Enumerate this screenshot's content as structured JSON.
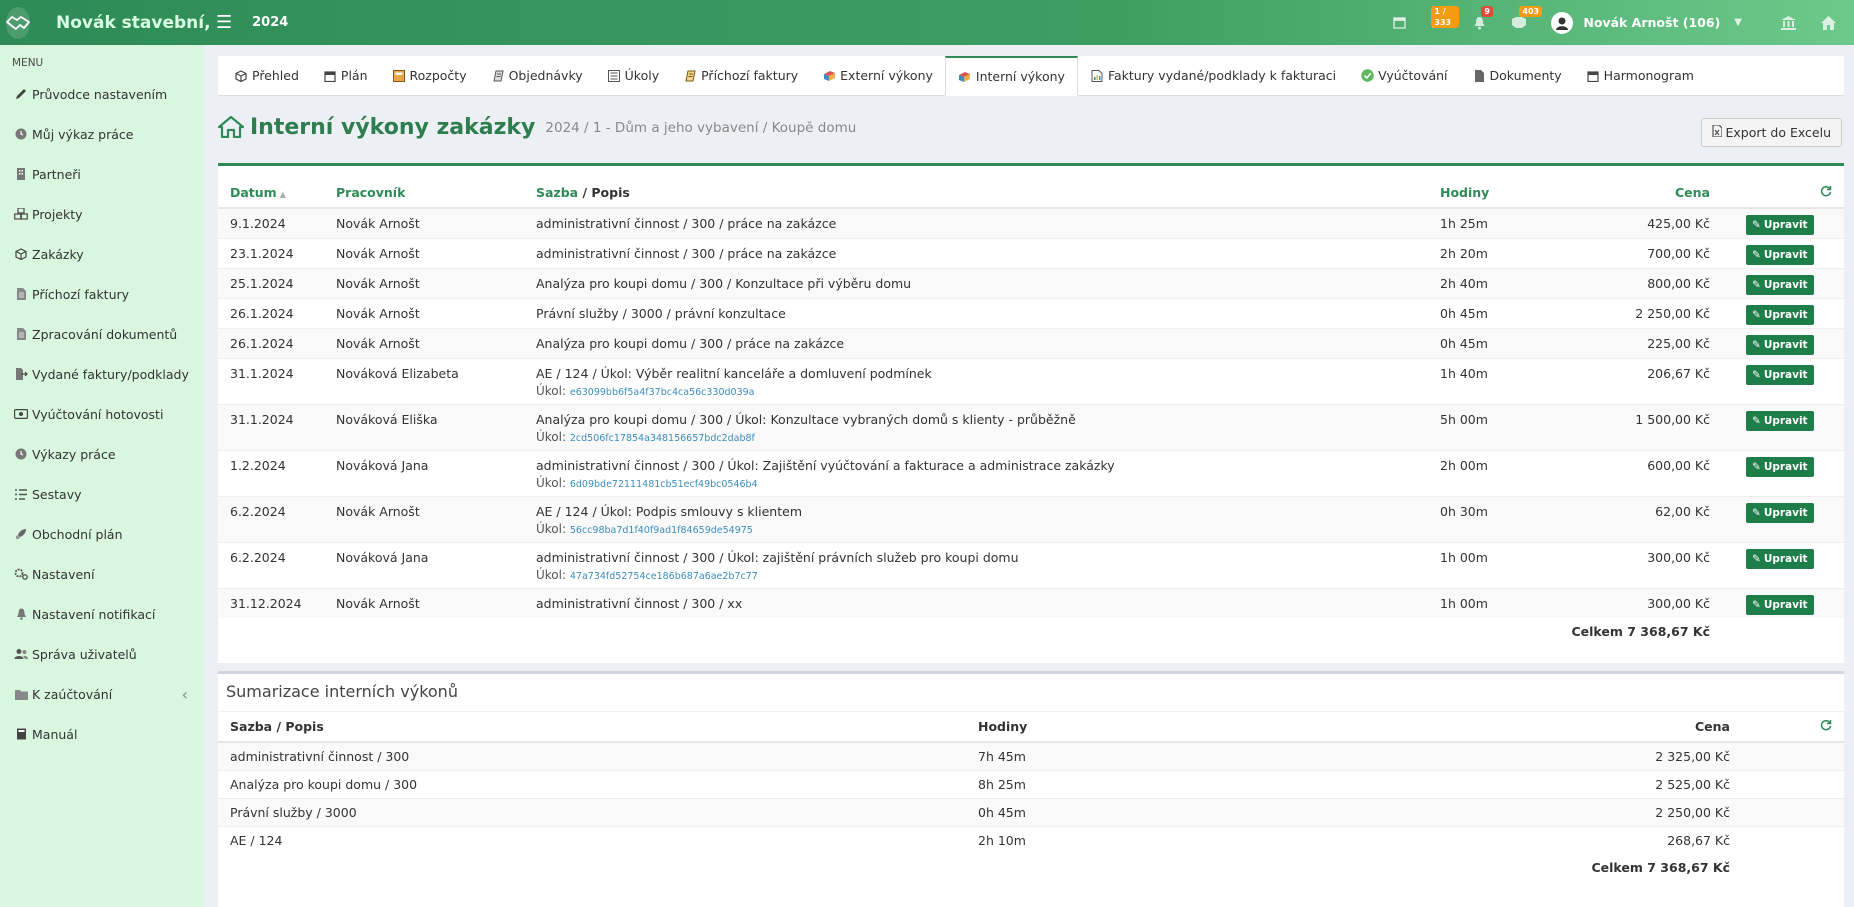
{
  "topbar": {
    "brand": "Novák stavební,",
    "year": "2024",
    "badges": {
      "tasks": "1 / 333",
      "notifications": "9",
      "messages": "403"
    },
    "user_name": "Novák Arnošt (106)"
  },
  "sidebar": {
    "menu_label": "MENU",
    "items": [
      {
        "label": "Průvodce nastavením",
        "icon": "pencil-icon"
      },
      {
        "label": "Můj výkaz práce",
        "icon": "clock-icon"
      },
      {
        "label": "Partneři",
        "icon": "building-icon"
      },
      {
        "label": "Projekty",
        "icon": "cubes-icon"
      },
      {
        "label": "Zakázky",
        "icon": "cube-icon"
      },
      {
        "label": "Příchozí faktury",
        "icon": "document-icon"
      },
      {
        "label": "Zpracování dokumentů",
        "icon": "document-icon"
      },
      {
        "label": "Vydané faktury/podklady",
        "icon": "export-icon"
      },
      {
        "label": "Vyúčtování hotovosti",
        "icon": "money-icon"
      },
      {
        "label": "Výkazy práce",
        "icon": "clock-icon"
      },
      {
        "label": "Sestavy",
        "icon": "list-icon"
      },
      {
        "label": "Obchodní plán",
        "icon": "rocket-icon"
      },
      {
        "label": "Nastavení",
        "icon": "gears-icon"
      },
      {
        "label": "Nastavení notifikací",
        "icon": "bell-icon"
      },
      {
        "label": "Správa uživatelů",
        "icon": "users-icon"
      },
      {
        "label": "K zaúčtování",
        "icon": "folder-icon"
      },
      {
        "label": "Manuál",
        "icon": "book-icon"
      }
    ]
  },
  "tabs": [
    {
      "label": "Přehled",
      "icon": "cube-icon"
    },
    {
      "label": "Plán",
      "icon": "calendar-icon"
    },
    {
      "label": "Rozpočty",
      "icon": "calculator-icon"
    },
    {
      "label": "Objednávky",
      "icon": "order-icon"
    },
    {
      "label": "Úkoly",
      "icon": "tasks-icon"
    },
    {
      "label": "Příchozí faktury",
      "icon": "invoice-icon"
    },
    {
      "label": "Externí výkony",
      "icon": "books-icon"
    },
    {
      "label": "Interní výkony",
      "icon": "books-icon",
      "active": true
    },
    {
      "label": "Faktury vydané/podklady k fakturaci",
      "icon": "chart-doc-icon"
    },
    {
      "label": "Vyúčtování",
      "icon": "check-icon"
    },
    {
      "label": "Dokumenty",
      "icon": "file-icon"
    },
    {
      "label": "Harmonogram",
      "icon": "calendar-icon"
    }
  ],
  "page": {
    "title": "Interní výkony zakázky",
    "subtitle": "2024 / 1 - Dům a jeho vybavení / Koupě domu",
    "export_label": "Export do Excelu"
  },
  "table": {
    "headers": {
      "date": "Datum",
      "worker": "Pracovník",
      "rate": "Sazba",
      "sep": " / ",
      "desc": "Popis",
      "hours": "Hodiny",
      "price": "Cena"
    },
    "edit_label": "Upravit",
    "task_label": "Úkol:",
    "rows": [
      {
        "date": "9.1.2024",
        "worker": "Novák Arnošt",
        "desc": "administrativní činnost / 300 / práce na zakázce",
        "hours": "1h 25m",
        "price": "425,00 Kč"
      },
      {
        "date": "23.1.2024",
        "worker": "Novák Arnošt",
        "desc": "administrativní činnost / 300 / práce na zakázce",
        "hours": "2h 20m",
        "price": "700,00 Kč"
      },
      {
        "date": "25.1.2024",
        "worker": "Novák Arnošt",
        "desc": "Analýza pro koupi domu / 300 / Konzultace při výběru domu",
        "hours": "2h 40m",
        "price": "800,00 Kč"
      },
      {
        "date": "26.1.2024",
        "worker": "Novák Arnošt",
        "desc": "Právní služby / 3000 / právní konzultace",
        "hours": "0h 45m",
        "price": "2 250,00 Kč"
      },
      {
        "date": "26.1.2024",
        "worker": "Novák Arnošt",
        "desc": "Analýza pro koupi domu / 300 / práce na zakázce",
        "hours": "0h 45m",
        "price": "225,00 Kč"
      },
      {
        "date": "31.1.2024",
        "worker": "Nováková Elizabeta",
        "desc": "AE / 124 / Úkol: Výběr realitní kanceláře a domluvení podmínek",
        "task_id": "e63099bb6f5a4f37bc4ca56c330d039a",
        "hours": "1h 40m",
        "price": "206,67 Kč"
      },
      {
        "date": "31.1.2024",
        "worker": "Nováková Eliška",
        "desc": "Analýza pro koupi domu / 300 / Úkol: Konzultace vybraných domů s klienty - průběžně",
        "task_id": "2cd506fc17854a348156657bdc2dab8f",
        "hours": "5h 00m",
        "price": "1 500,00 Kč"
      },
      {
        "date": "1.2.2024",
        "worker": "Nováková Jana",
        "desc": "administrativní činnost / 300 / Úkol: Zajištění vyúčtování a fakturace a administrace zakázky",
        "task_id": "6d09bde72111481cb51ecf49bc0546b4",
        "hours": "2h 00m",
        "price": "600,00 Kč"
      },
      {
        "date": "6.2.2024",
        "worker": "Novák Arnošt",
        "desc": "AE / 124 / Úkol: Podpis smlouvy s klientem",
        "task_id": "56cc98ba7d1f40f9ad1f84659de54975",
        "hours": "0h 30m",
        "price": "62,00 Kč"
      },
      {
        "date": "6.2.2024",
        "worker": "Nováková Jana",
        "desc": "administrativní činnost / 300 / Úkol: zajištění právních služeb pro koupi domu",
        "task_id": "47a734fd52754ce186b687a6ae2b7c77",
        "hours": "1h 00m",
        "price": "300,00 Kč"
      },
      {
        "date": "31.12.2024",
        "worker": "Novák Arnošt",
        "desc": "administrativní činnost / 300 / xx",
        "hours": "1h 00m",
        "price": "300,00 Kč"
      }
    ],
    "total": "Celkem 7 368,67 Kč"
  },
  "summary": {
    "title": "Sumarizace interních výkonů",
    "headers": {
      "desc": "Sazba / Popis",
      "hours": "Hodiny",
      "price": "Cena"
    },
    "rows": [
      {
        "desc": "administrativní činnost / 300",
        "hours": "7h 45m",
        "price": "2 325,00 Kč"
      },
      {
        "desc": "Analýza pro koupi domu / 300",
        "hours": "8h 25m",
        "price": "2 525,00 Kč"
      },
      {
        "desc": "Právní služby / 3000",
        "hours": "0h 45m",
        "price": "2 250,00 Kč"
      },
      {
        "desc": "AE / 124",
        "hours": "2h 10m",
        "price": "268,67 Kč"
      }
    ],
    "total": "Celkem 7 368,67 Kč"
  }
}
